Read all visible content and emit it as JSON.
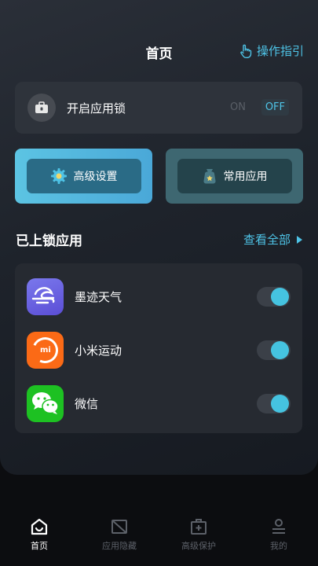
{
  "header": {
    "title": "首页",
    "guide_label": "操作指引"
  },
  "app_lock": {
    "label": "开启应用锁",
    "on_label": "ON",
    "off_label": "OFF",
    "enabled": false
  },
  "actions": {
    "advanced_settings": "高级设置",
    "common_apps": "常用应用"
  },
  "locked_apps": {
    "title": "已上锁应用",
    "view_all": "查看全部",
    "items": [
      {
        "name": "墨迹天气",
        "locked": true
      },
      {
        "name": "小米运动",
        "locked": true,
        "icon_text": "mi"
      },
      {
        "name": "微信",
        "locked": true
      }
    ]
  },
  "tabs": [
    {
      "label": "首页",
      "active": true
    },
    {
      "label": "应用隐藏",
      "active": false
    },
    {
      "label": "高级保护",
      "active": false
    },
    {
      "label": "我的",
      "active": false
    }
  ],
  "colors": {
    "accent": "#4ec3e6",
    "toggle_on": "#45c3e0",
    "background": "#0c0d10"
  }
}
